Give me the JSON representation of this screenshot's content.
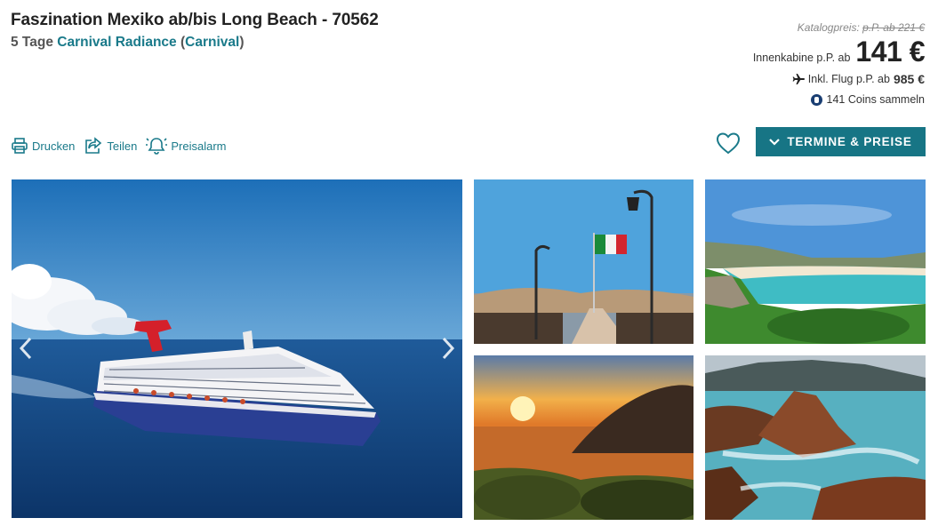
{
  "header": {
    "title": "Faszination Mexiko ab/bis Long Beach - 70562",
    "duration": "5 Tage",
    "ship_name": "Carnival Radiance",
    "paren_open": "(",
    "line_name": "Carnival",
    "paren_close": ")"
  },
  "pricing": {
    "catalog_label": "Katalogpreis:",
    "catalog_value": "p.P. ab 221 €",
    "cabin_label": "Innenkabine p.P. ab",
    "cabin_price": "141 €",
    "flight_label": "Inkl. Flug p.P. ab",
    "flight_price": "985 €",
    "coins_text": "141 Coins sammeln"
  },
  "actions": {
    "print": "Drucken",
    "share": "Teilen",
    "alarm": "Preisalarm"
  },
  "cta": {
    "label": "TERMINE & PREISE"
  },
  "colors": {
    "accent": "#177585",
    "link": "#1a7a8a",
    "coin": "#1a3e72"
  },
  "icons": [
    "printer-icon",
    "share-icon",
    "bell-icon",
    "heart-icon",
    "chevron-down-icon",
    "plane-icon",
    "coin-icon",
    "arrow-left-icon",
    "arrow-right-icon"
  ]
}
